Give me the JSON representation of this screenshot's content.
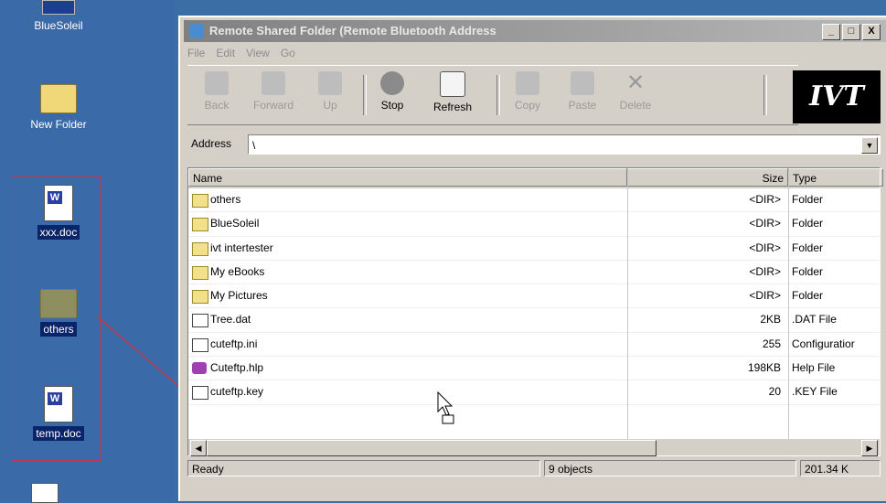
{
  "desktop": {
    "icons": [
      {
        "label": "BlueSoleil"
      },
      {
        "label": "New Folder"
      },
      {
        "label": "xxx.doc"
      },
      {
        "label": "others"
      },
      {
        "label": "temp.doc"
      }
    ]
  },
  "window": {
    "title": "Remote Shared Folder (Remote Bluetooth Address",
    "controls": {
      "minimize": "_",
      "maximize": "□",
      "close": "X"
    },
    "menu": [
      "File",
      "Edit",
      "View",
      "Go"
    ],
    "toolbar": [
      {
        "label": "Back",
        "enabled": false,
        "icon": "back-arrow-icon"
      },
      {
        "label": "Forward",
        "enabled": false,
        "icon": "forward-arrow-icon"
      },
      {
        "label": "Up",
        "enabled": false,
        "icon": "up-folder-icon"
      },
      {
        "label": "Stop",
        "enabled": true,
        "icon": "stop-icon"
      },
      {
        "label": "Refresh",
        "enabled": true,
        "icon": "refresh-icon"
      },
      {
        "label": "Copy",
        "enabled": false,
        "icon": "copy-icon"
      },
      {
        "label": "Paste",
        "enabled": false,
        "icon": "paste-icon"
      },
      {
        "label": "Delete",
        "enabled": false,
        "icon": "delete-icon"
      }
    ],
    "logo": "IVT",
    "address": {
      "label": "Address",
      "value": "\\"
    },
    "columns": {
      "name": "Name",
      "size": "Size",
      "type": "Type"
    },
    "files": [
      {
        "name": "others",
        "size": "<DIR>",
        "type": "Folder",
        "kind": "folder"
      },
      {
        "name": "BlueSoleil",
        "size": "<DIR>",
        "type": "Folder",
        "kind": "folder"
      },
      {
        "name": "ivt intertester",
        "size": "<DIR>",
        "type": "Folder",
        "kind": "folder"
      },
      {
        "name": "My eBooks",
        "size": "<DIR>",
        "type": "Folder",
        "kind": "folder"
      },
      {
        "name": "My Pictures",
        "size": "<DIR>",
        "type": "Folder",
        "kind": "folder"
      },
      {
        "name": "Tree.dat",
        "size": "2KB",
        "type": ".DAT File",
        "kind": "file"
      },
      {
        "name": "cuteftp.ini",
        "size": "255",
        "type": "Configuratior",
        "kind": "file"
      },
      {
        "name": "Cuteftp.hlp",
        "size": "198KB",
        "type": "Help File",
        "kind": "help"
      },
      {
        "name": "cuteftp.key",
        "size": "20",
        "type": ".KEY File",
        "kind": "file"
      }
    ],
    "status": {
      "text": "Ready",
      "count": "9 objects",
      "size": "201.34 K"
    }
  },
  "colors": {
    "desktop": "#3a6ba8",
    "selection": "#0a246a",
    "drag_line": "#c0394b"
  }
}
